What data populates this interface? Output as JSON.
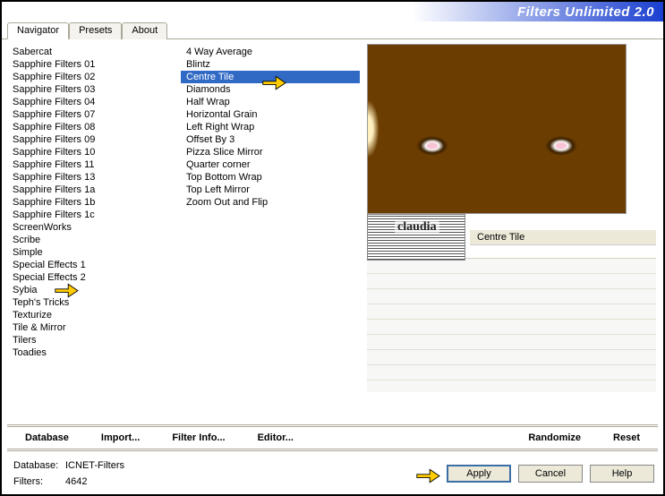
{
  "title": "Filters Unlimited 2.0",
  "tabs": [
    {
      "label": "Navigator",
      "active": true
    },
    {
      "label": "Presets",
      "active": false
    },
    {
      "label": "About",
      "active": false
    }
  ],
  "categories": [
    "Sabercat",
    "Sapphire Filters 01",
    "Sapphire Filters 02",
    "Sapphire Filters 03",
    "Sapphire Filters 04",
    "Sapphire Filters 07",
    "Sapphire Filters 08",
    "Sapphire Filters 09",
    "Sapphire Filters 10",
    "Sapphire Filters 11",
    "Sapphire Filters 13",
    "Sapphire Filters 1a",
    "Sapphire Filters 1b",
    "Sapphire Filters 1c",
    "ScreenWorks",
    "Scribe",
    "Simple",
    "Special Effects 1",
    "Special Effects 2",
    "Sybia",
    "Teph's Tricks",
    "Texturize",
    "Tile & Mirror",
    "Tilers",
    "Toadies"
  ],
  "category_selected": "Simple",
  "filters": [
    "4 Way Average",
    "Blintz",
    "Centre Tile",
    "Diamonds",
    "Half Wrap",
    "Horizontal Grain",
    "Left Right Wrap",
    "Offset By 3",
    "Pizza Slice Mirror",
    "Quarter corner",
    "Top Bottom Wrap",
    "Top Left Mirror",
    "Zoom Out and Flip"
  ],
  "filter_selected": "Centre Tile",
  "current_filter_label": "Centre Tile",
  "toolbar": {
    "database": "Database",
    "import": "Import...",
    "filter_info": "Filter Info...",
    "editor": "Editor...",
    "randomize": "Randomize",
    "reset": "Reset"
  },
  "buttons": {
    "apply": "Apply",
    "cancel": "Cancel",
    "help": "Help"
  },
  "status": {
    "db_label": "Database:",
    "db_value": "ICNET-Filters",
    "filters_label": "Filters:",
    "filters_value": "4642"
  },
  "watermark_text": "claudia"
}
